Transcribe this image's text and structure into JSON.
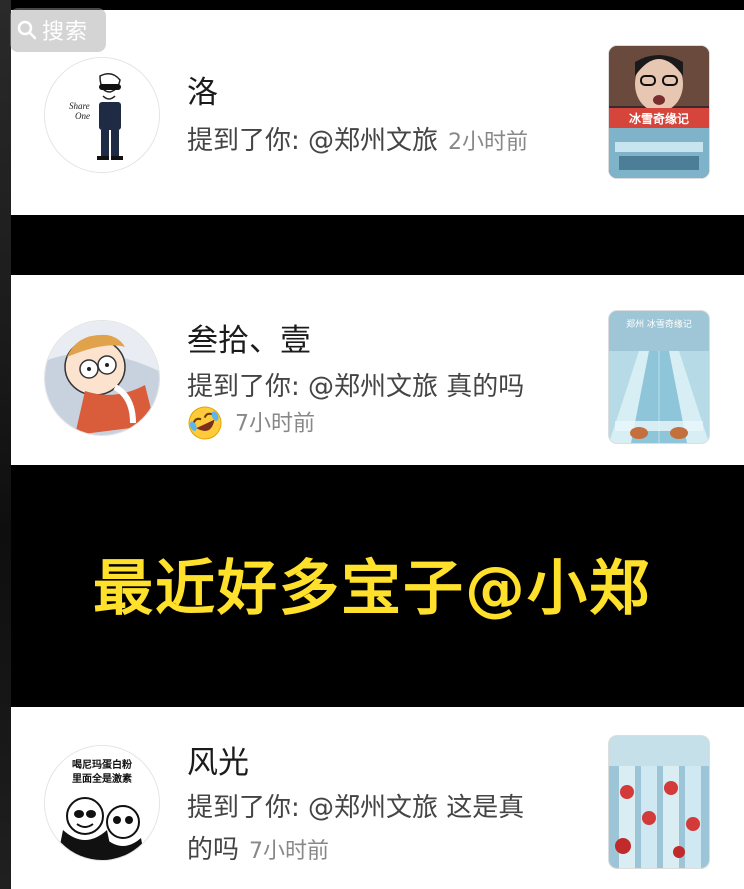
{
  "search": {
    "label": "搜索"
  },
  "notifications": [
    {
      "name": "洛",
      "action": "提到了你: @郑州文旅",
      "time": "2小时前",
      "avatar_icon": "fashion-boy-avatar-icon",
      "thumb_caption": "冰雪奇缘记"
    },
    {
      "name": "叁拾、壹",
      "action": "提到了你: @郑州文旅 真的吗",
      "emoji": "rofl-emoji-icon",
      "time": "7小时前",
      "avatar_icon": "cartoon-sleeping-avatar-icon",
      "thumb_caption": "郑州 冰雪奇缘记"
    },
    {
      "name": "风光",
      "action_line1": "提到了你: @郑州文旅 这是真",
      "action_line2": "的吗",
      "time": "7小时前",
      "avatar_icon": "panda-meme-avatar-icon",
      "avatar_text": "喝尼玛蛋白粉 里面全是激素"
    }
  ],
  "caption": "最近好多宝子@小郑",
  "colors": {
    "caption": "#ffe02a",
    "background": "#000000",
    "card": "#ffffff"
  }
}
